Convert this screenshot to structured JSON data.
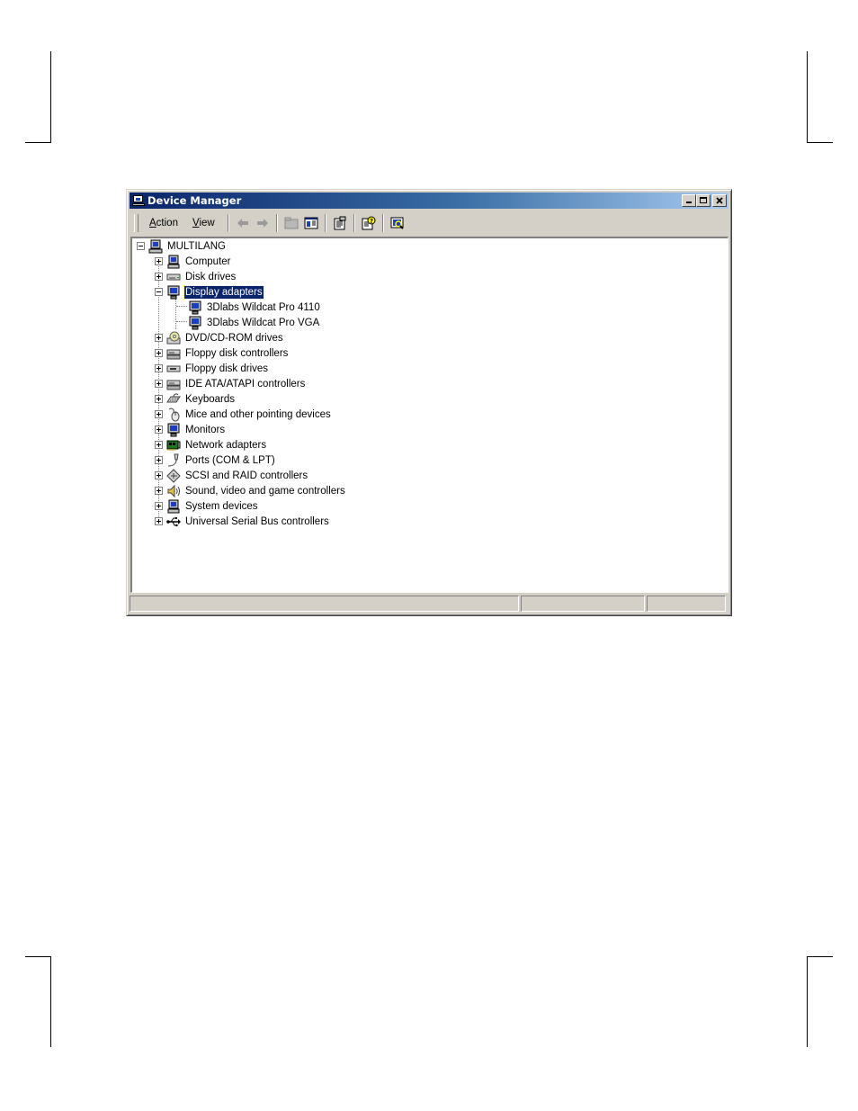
{
  "window": {
    "title": "Device Manager",
    "controls": {
      "minimize": "_",
      "maximize": "□",
      "close": "✕"
    }
  },
  "menu": {
    "items": [
      {
        "label": "Action",
        "mnemonic": "A"
      },
      {
        "label": "View",
        "mnemonic": "V"
      }
    ]
  },
  "toolbar": {
    "buttons": [
      "back-arrow-icon",
      "forward-arrow-icon",
      "up-folder-icon",
      "show-hide-tree-icon",
      "properties-icon",
      "help-icon",
      "scan-hardware-icon"
    ]
  },
  "tree": {
    "root": {
      "label": "MULTILANG",
      "icon": "computer-icon",
      "expanded": true
    },
    "categories": [
      {
        "label": "Computer",
        "icon": "computer-icon",
        "expanded": false
      },
      {
        "label": "Disk drives",
        "icon": "disk-drive-icon",
        "expanded": false
      },
      {
        "label": "Display adapters",
        "icon": "display-adapter-icon",
        "expanded": true,
        "selected": true,
        "children": [
          {
            "label": "3Dlabs Wildcat Pro 4110",
            "icon": "display-adapter-icon"
          },
          {
            "label": "3Dlabs Wildcat Pro VGA",
            "icon": "display-adapter-icon"
          }
        ]
      },
      {
        "label": "DVD/CD-ROM drives",
        "icon": "cdrom-icon",
        "expanded": false
      },
      {
        "label": "Floppy disk controllers",
        "icon": "controller-icon",
        "expanded": false
      },
      {
        "label": "Floppy disk drives",
        "icon": "floppy-drive-icon",
        "expanded": false
      },
      {
        "label": "IDE ATA/ATAPI controllers",
        "icon": "controller-icon",
        "expanded": false
      },
      {
        "label": "Keyboards",
        "icon": "keyboard-icon",
        "expanded": false
      },
      {
        "label": "Mice and other pointing devices",
        "icon": "mouse-icon",
        "expanded": false
      },
      {
        "label": "Monitors",
        "icon": "monitor-icon",
        "expanded": false
      },
      {
        "label": "Network adapters",
        "icon": "network-adapter-icon",
        "expanded": false
      },
      {
        "label": "Ports (COM & LPT)",
        "icon": "port-icon",
        "expanded": false
      },
      {
        "label": "SCSI and RAID controllers",
        "icon": "scsi-icon",
        "expanded": false
      },
      {
        "label": "Sound, video and game controllers",
        "icon": "sound-icon",
        "expanded": false
      },
      {
        "label": "System devices",
        "icon": "computer-icon",
        "expanded": false
      },
      {
        "label": "Universal Serial Bus controllers",
        "icon": "usb-icon",
        "expanded": false
      }
    ]
  },
  "colors": {
    "face": "#d4d0c8",
    "title_start": "#0a246a",
    "title_end": "#a6caf0",
    "selection": "#0a246a"
  }
}
